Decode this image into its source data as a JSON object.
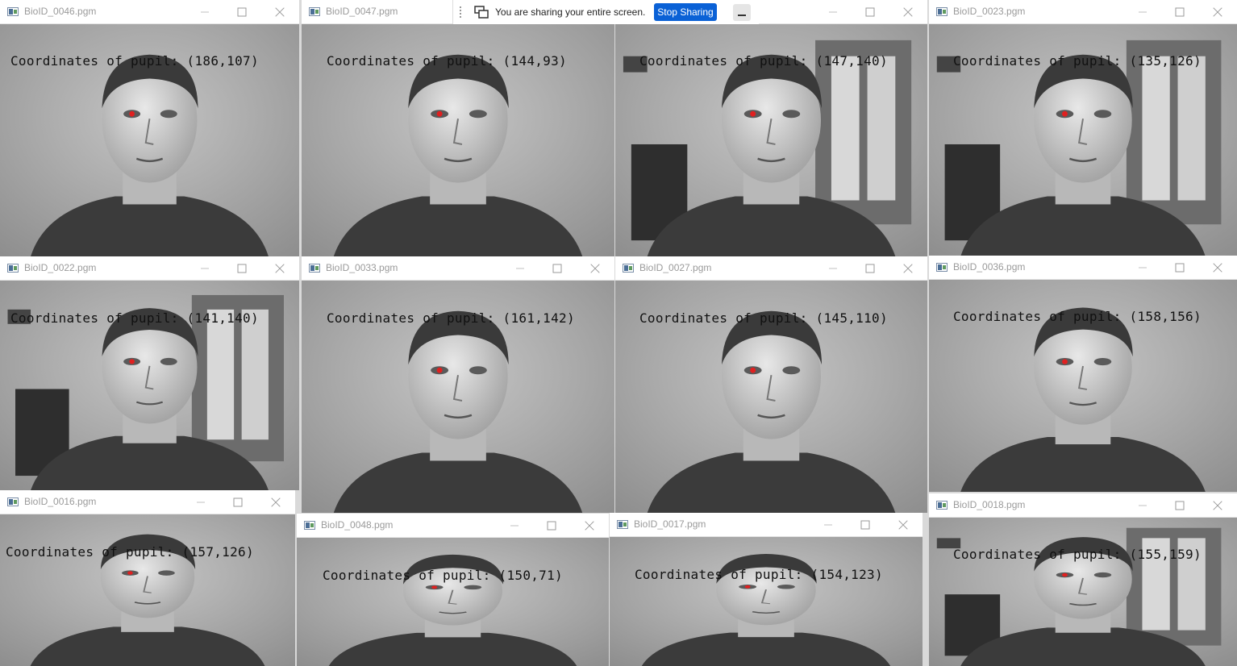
{
  "colors": {
    "title_text": "#9a9a9a",
    "accent": "#0a61d6",
    "pupil_marker": "#e02020"
  },
  "share_bar": {
    "message": "You are sharing your entire screen.",
    "stop_label": "Stop Sharing"
  },
  "windows": [
    {
      "title": "BioID_0046.pgm",
      "coords": "Coordinates  of  pupil:  (186,107)"
    },
    {
      "title": "BioID_0047.pgm",
      "coords": "Coordinates  of  pupil:  (144,93)"
    },
    {
      "title": "",
      "coords": "Coordinates  of  pupil:  (147,140)"
    },
    {
      "title": "BioID_0023.pgm",
      "coords": "Coordinates  of  pupil:  (135,126)"
    },
    {
      "title": "BioID_0022.pgm",
      "coords": "Coordinates  of  pupil:  (141,140)"
    },
    {
      "title": "BioID_0033.pgm",
      "coords": "Coordinates  of  pupil:  (161,142)"
    },
    {
      "title": "BioID_0027.pgm",
      "coords": "Coordinates  of  pupil:  (145,110)"
    },
    {
      "title": "BioID_0036.pgm",
      "coords": "Coordinates  of  pupil:  (158,156)"
    },
    {
      "title": "BioID_0016.pgm",
      "coords": "Coordinates  of  pupil:  (157,126)"
    },
    {
      "title": "BioID_0048.pgm",
      "coords": "Coordinates  of  pupil:  (150,71)"
    },
    {
      "title": "BioID_0017.pgm",
      "coords": "Coordinates  of  pupil:  (154,123)"
    },
    {
      "title": "BioID_0018.pgm",
      "coords": "Coordinates  of  pupil:  (155,159)"
    }
  ]
}
